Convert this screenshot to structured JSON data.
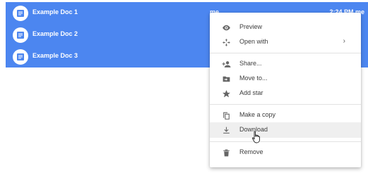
{
  "files": [
    {
      "name": "Example Doc 1",
      "owner": "me",
      "modified": "2:24 PM  me"
    },
    {
      "name": "Example Doc 2",
      "owner": "",
      "modified": ""
    },
    {
      "name": "Example Doc 3",
      "owner": "",
      "modified": ""
    }
  ],
  "context_menu": {
    "items": [
      {
        "label": "Preview",
        "icon": "eye-icon"
      },
      {
        "label": "Open with",
        "icon": "move-arrows-icon",
        "submenu_indicator": "›"
      },
      {
        "label": "Share...",
        "icon": "add-person-icon"
      },
      {
        "label": "Move to...",
        "icon": "folder-move-icon"
      },
      {
        "label": "Add star",
        "icon": "star-icon"
      },
      {
        "label": "Make a copy",
        "icon": "copy-icon"
      },
      {
        "label": "Download",
        "icon": "download-icon"
      },
      {
        "label": "Remove",
        "icon": "trash-icon"
      }
    ]
  },
  "colors": {
    "selection": "#4c86f0",
    "menu_text": "#3c3c3c",
    "icon": "#666666",
    "hover": "#efefef"
  }
}
